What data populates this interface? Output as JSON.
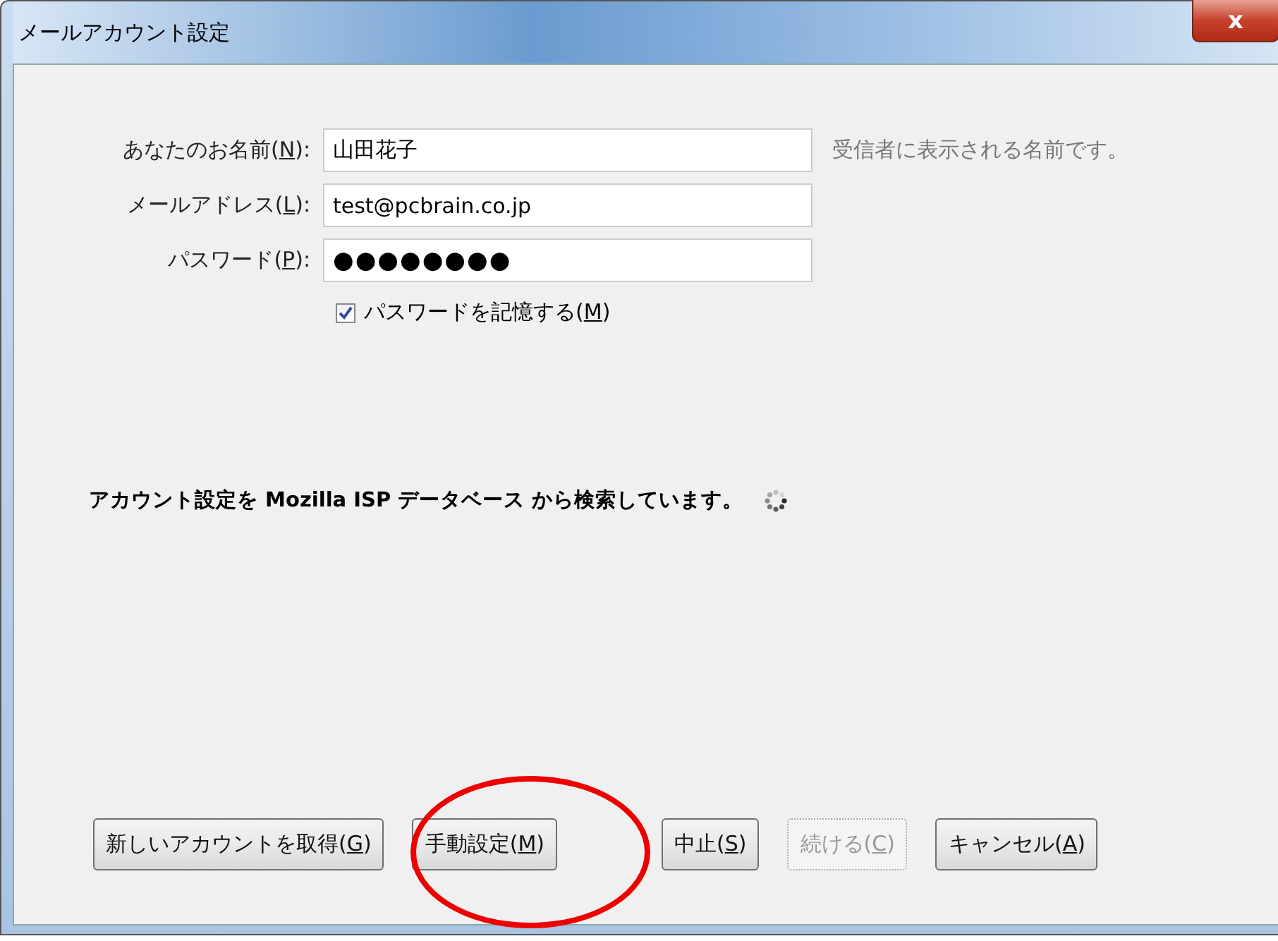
{
  "window": {
    "title": "メールアカウント設定",
    "close_button": "x"
  },
  "fields": [
    {
      "label": [
        "あなたのお名前(",
        "N",
        "):"
      ],
      "kind": "text",
      "value": "山田花子",
      "hint": "受信者に表示される名前です。"
    },
    {
      "label": [
        "メールアドレス(",
        "L",
        "):"
      ],
      "kind": "text",
      "value": "test@pcbrain.co.jp"
    },
    {
      "label": [
        "パスワード(",
        "P",
        "):"
      ],
      "kind": "password",
      "value": "●●●●●●●●"
    }
  ],
  "remember_password": {
    "label": [
      "パスワードを記憶する(",
      "M",
      ")"
    ],
    "checked": true
  },
  "status": {
    "text": "アカウント設定を Mozilla ISP データベース から検索しています。",
    "busy": true
  },
  "buttons": [
    {
      "label": [
        "新しいアカウントを取得(",
        "G",
        ")"
      ],
      "disabled": false,
      "highlighted": false
    },
    {
      "label": [
        "手動設定(",
        "M",
        ")"
      ],
      "disabled": false,
      "highlighted": true
    },
    {
      "label": [
        "中止(",
        "S",
        ")"
      ],
      "disabled": false,
      "highlighted": false
    },
    {
      "label": [
        "続ける(",
        "C",
        ")"
      ],
      "disabled": true,
      "highlighted": false
    },
    {
      "label": [
        "キャンセル(",
        "A",
        ")"
      ],
      "disabled": false,
      "highlighted": false
    }
  ],
  "annotation": {
    "kind": "ellipse"
  }
}
